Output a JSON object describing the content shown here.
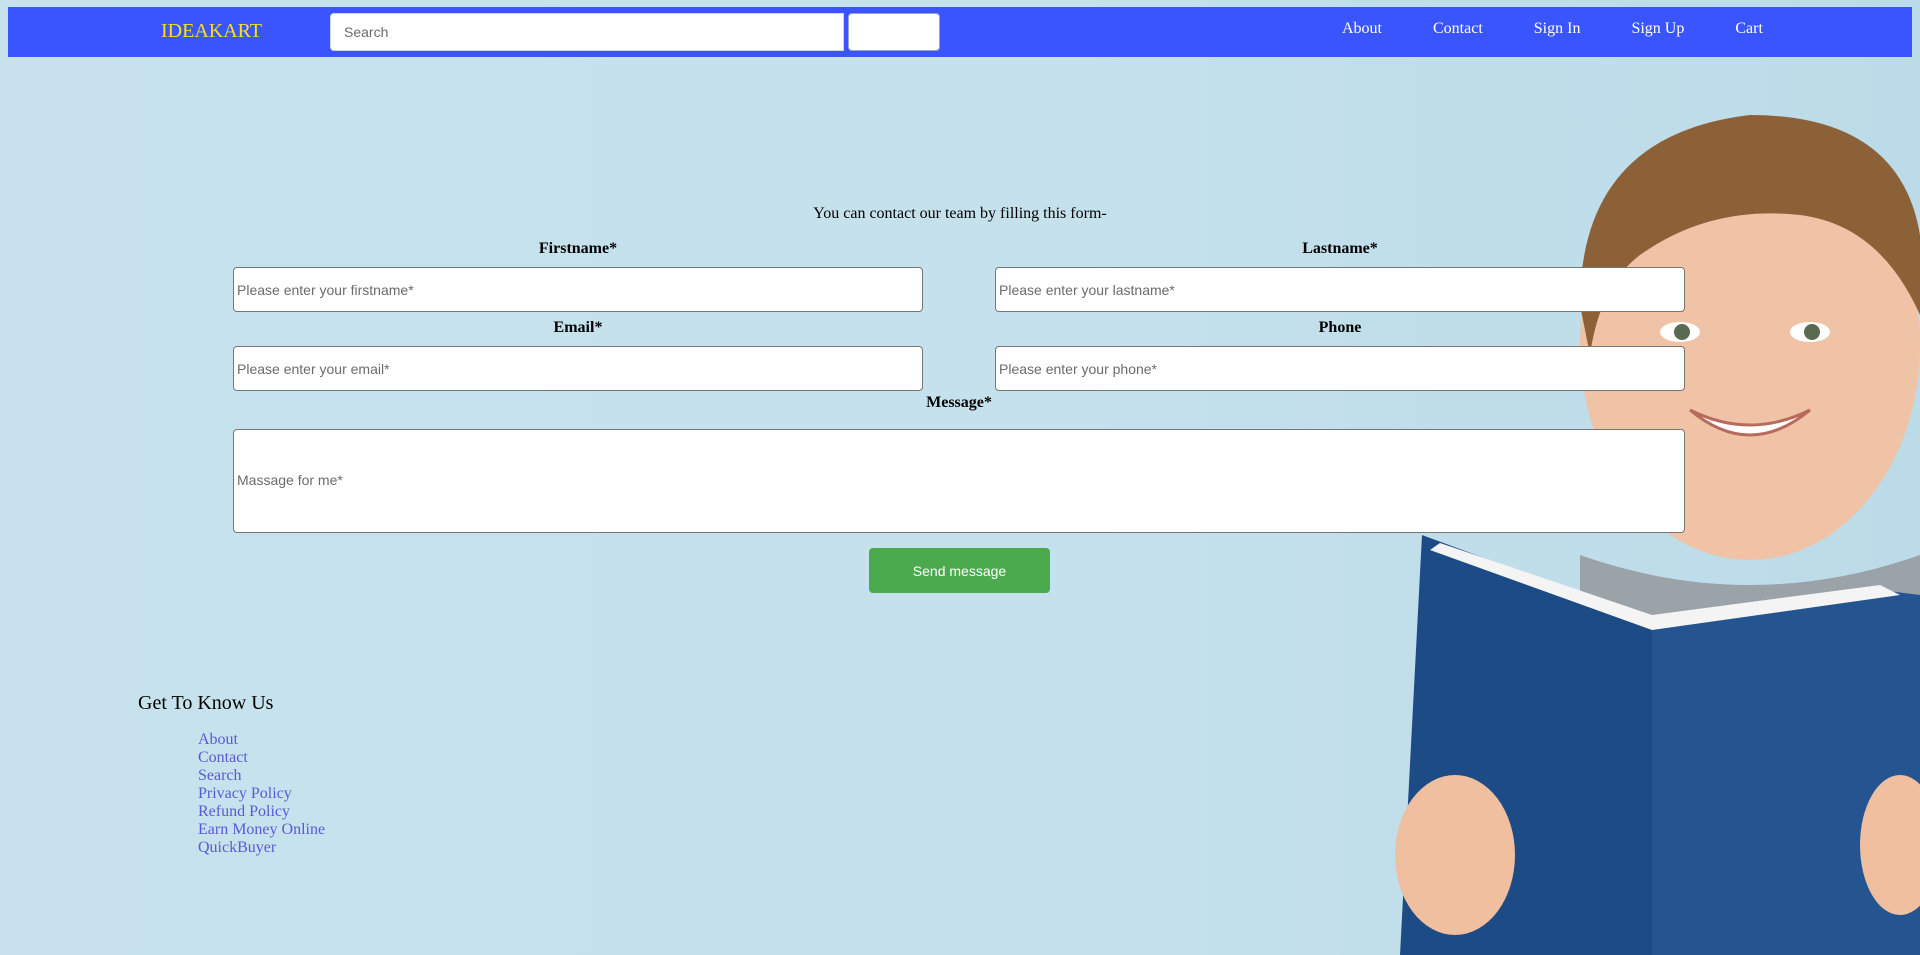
{
  "brand": "IDEAKART",
  "search": {
    "placeholder": "Search",
    "button_label": ""
  },
  "nav": [
    "About",
    "Contact",
    "Sign In",
    "Sign Up",
    "Cart"
  ],
  "form": {
    "intro": "You can contact our team by filling this form-",
    "firstname_label": "Firstname*",
    "firstname_placeholder": "Please enter your firstname*",
    "lastname_label": "Lastname*",
    "lastname_placeholder": "Please enter your lastname*",
    "email_label": "Email*",
    "email_placeholder": "Please enter your email*",
    "phone_label": "Phone",
    "phone_placeholder": "Please enter your phone*",
    "message_label": "Message*",
    "message_placeholder": "Massage for me*",
    "submit_label": "Send message"
  },
  "footer": {
    "title": "Get To Know Us",
    "links": [
      "About",
      "Contact",
      "Search",
      "Privacy Policy",
      "Refund Policy",
      "Earn Money Online",
      "QuickBuyer"
    ]
  },
  "colors": {
    "navbar": "#3b55fe",
    "brand": "#f7e01a",
    "submit": "#4caa4e",
    "footer_link": "#5a5ad6"
  }
}
